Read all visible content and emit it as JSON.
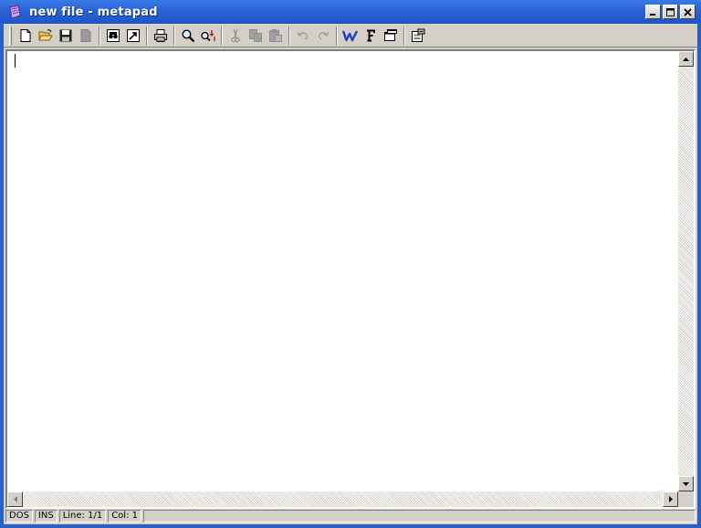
{
  "window": {
    "title": "new file - metapad",
    "controls": [
      "minimize-icon",
      "maximize-icon",
      "close-icon"
    ]
  },
  "toolbar": {
    "buttons": [
      {
        "name": "new-file",
        "icon": "new-file-icon",
        "enabled": true
      },
      {
        "name": "open-file",
        "icon": "folder-open-icon",
        "enabled": true
      },
      {
        "name": "save",
        "icon": "floppy-disk-icon",
        "enabled": true
      },
      {
        "name": "save-as",
        "icon": "document-gray-icon",
        "enabled": false
      },
      {
        "name": "launch-viewer",
        "icon": "binoculars-icon",
        "enabled": true
      },
      {
        "name": "launch-secondary",
        "icon": "external-arrow-icon",
        "enabled": true
      },
      {
        "name": "print",
        "icon": "printer-icon",
        "enabled": true
      },
      {
        "name": "find",
        "icon": "magnifier-icon",
        "enabled": true
      },
      {
        "name": "replace",
        "icon": "find-replace-icon",
        "enabled": true
      },
      {
        "name": "cut",
        "icon": "scissors-icon",
        "enabled": false
      },
      {
        "name": "copy",
        "icon": "copy-icon",
        "enabled": false
      },
      {
        "name": "paste",
        "icon": "paste-icon",
        "enabled": false
      },
      {
        "name": "undo",
        "icon": "undo-icon",
        "enabled": false
      },
      {
        "name": "redo",
        "icon": "redo-icon",
        "enabled": false
      },
      {
        "name": "word-wrap",
        "icon": "word-wrap-w-icon",
        "enabled": true,
        "glyph": "W"
      },
      {
        "name": "font",
        "icon": "font-f-icon",
        "enabled": true,
        "glyph": "F"
      },
      {
        "name": "always-on-top",
        "icon": "window-on-top-icon",
        "enabled": true
      },
      {
        "name": "settings",
        "icon": "settings-icon",
        "enabled": true
      }
    ]
  },
  "editor": {
    "content": ""
  },
  "statusbar": {
    "format": "DOS",
    "mode": "INS",
    "line": "Line: 1/1",
    "col": "Col: 1"
  },
  "colors": {
    "titlebar": "#2a63d6",
    "face": "#d4d0c8",
    "accent_blue": "#1f3fbf"
  }
}
